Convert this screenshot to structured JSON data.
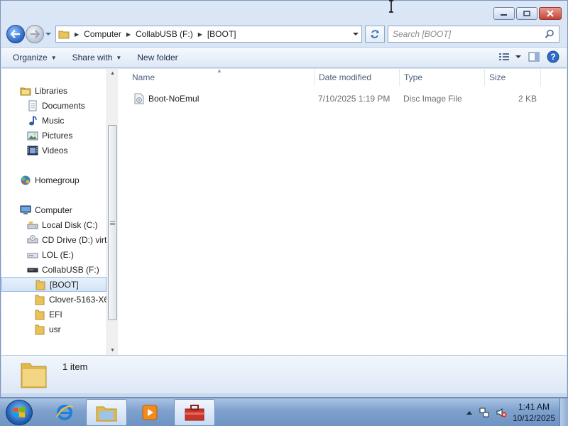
{
  "window": {
    "caption": {
      "minimize": "minimize",
      "maximize": "maximize",
      "close": "close"
    }
  },
  "address": {
    "crumbs": [
      "Computer",
      "CollabUSB (F:)",
      "[BOOT]"
    ],
    "search_placeholder": "Search [BOOT]"
  },
  "toolbar": {
    "organize": "Organize",
    "share_with": "Share with",
    "new_folder": "New folder"
  },
  "nav": {
    "libraries": "Libraries",
    "documents": "Documents",
    "music": "Music",
    "pictures": "Pictures",
    "videos": "Videos",
    "homegroup": "Homegroup",
    "computer": "Computer",
    "local_disk": "Local Disk (C:)",
    "cd_drive": "CD Drive (D:) virt",
    "lol": "LOL (E:)",
    "collabusb": "CollabUSB (F:)",
    "boot": "[BOOT]",
    "clover": "Clover-5163-X6",
    "efi": "EFI",
    "usr": "usr"
  },
  "columns": {
    "name": "Name",
    "date_modified": "Date modified",
    "type": "Type",
    "size": "Size"
  },
  "files": [
    {
      "name": "Boot-NoEmul",
      "date_modified": "7/10/2025 1:19 PM",
      "type": "Disc Image File",
      "size": "2 KB"
    }
  ],
  "details": {
    "count": "1 item"
  },
  "taskbar": {
    "time": "1:41 AM",
    "date": "10/12/2025"
  },
  "colors": {
    "folder": "#e8c35a",
    "accent": "#2a64c6",
    "close": "#c4443a"
  }
}
